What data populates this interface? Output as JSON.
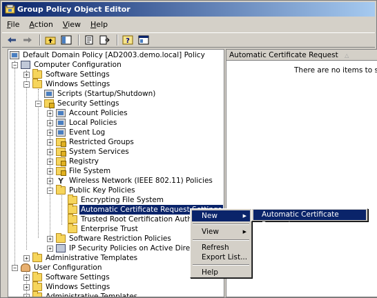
{
  "window": {
    "title": "Group Policy Object Editor"
  },
  "menubar": [
    {
      "label": "File",
      "accel": "F"
    },
    {
      "label": "Action",
      "accel": "A"
    },
    {
      "label": "View",
      "accel": "V"
    },
    {
      "label": "Help",
      "accel": "H"
    }
  ],
  "toolbar": {
    "back_icon": "back-arrow-icon",
    "forward_icon": "forward-arrow-icon",
    "up_icon": "up-folder-icon",
    "show_hide_tree_icon": "show-hide-tree-icon",
    "properties_icon": "properties-icon",
    "export_icon": "export-list-icon",
    "help_icon": "help-icon",
    "console_icon": "console-icon"
  },
  "tree": {
    "root": "Default Domain Policy [AD2003.demo.local] Policy",
    "computer_configuration": "Computer Configuration",
    "cc_software_settings": "Software Settings",
    "cc_windows_settings": "Windows Settings",
    "scripts": "Scripts (Startup/Shutdown)",
    "security_settings": "Security Settings",
    "account_policies": "Account Policies",
    "local_policies": "Local Policies",
    "event_log": "Event Log",
    "restricted_groups": "Restricted Groups",
    "system_services": "System Services",
    "registry": "Registry",
    "file_system": "File System",
    "wireless": "Wireless Network (IEEE 802.11) Policies",
    "public_key": "Public Key Policies",
    "efs": "Encrypting File System",
    "auto_cert": "Automatic Certificate Request Settings",
    "trusted_root": "Trusted Root Certification Authorities",
    "enterprise_trust": "Enterprise Trust",
    "software_restriction": "Software Restriction Policies",
    "ipsec": "IP Security Policies on Active Directory (der",
    "cc_admin_templates": "Administrative Templates",
    "user_configuration": "User Configuration",
    "uc_software_settings": "Software Settings",
    "uc_windows_settings": "Windows Settings",
    "uc_admin_templates": "Administrative Templates"
  },
  "list": {
    "column_header": "Automatic Certificate Request",
    "empty_message": "There are no items to show i"
  },
  "context_menu": {
    "new": "New",
    "view": "View",
    "refresh": "Refresh",
    "export_list": "Export List...",
    "help": "Help"
  },
  "submenu": {
    "item": "Automatic Certificate Request..."
  },
  "colors": {
    "title_gradient_start": "#0a246a",
    "title_gradient_end": "#a6caf0",
    "selection": "#0a246a",
    "chrome": "#d4d0c8"
  }
}
